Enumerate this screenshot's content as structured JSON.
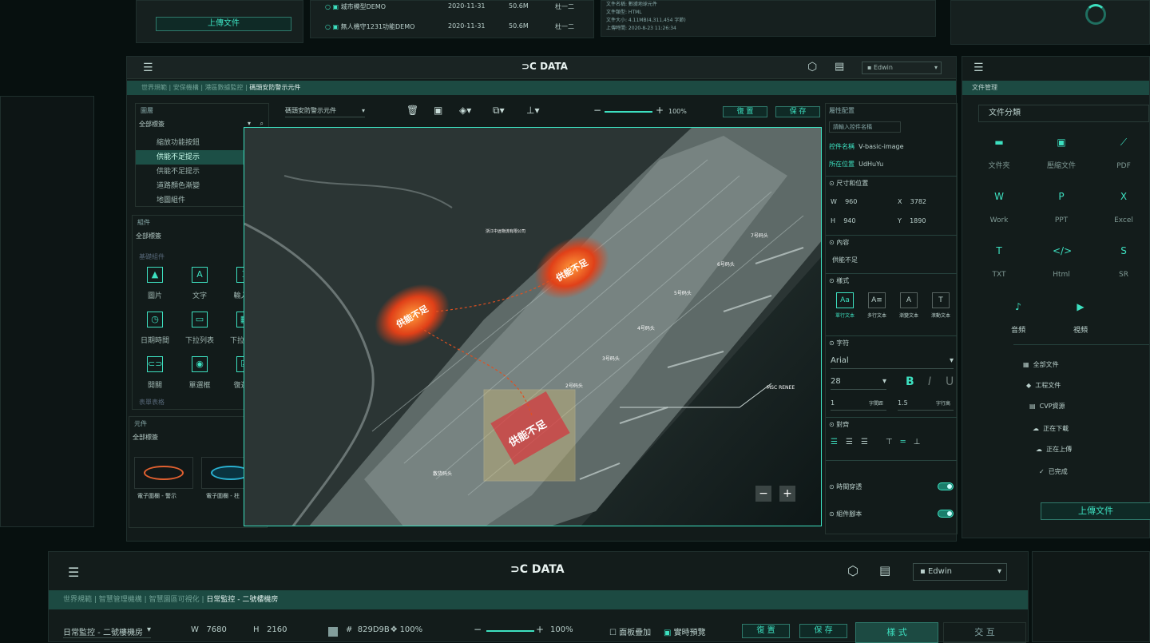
{
  "top_strip": {
    "upload_label": "上傳文件",
    "files": [
      {
        "name": "城市模型DEMO",
        "date": "2020-11-31",
        "size": "50.6M",
        "owner": "杜一二"
      },
      {
        "name": "無人機守1231功能DEMO",
        "date": "2020-11-31",
        "size": "50.6M",
        "owner": "杜一二"
      }
    ],
    "info_lines": [
      "文件名稱:   數據地球元件",
      "文件類型:   HTML",
      "文件大小:   4.11MB(4,311,454 字節)",
      "上傳時間:   2020-8-23   11:26:34"
    ]
  },
  "header": {
    "logo_text": "DATA",
    "user": "Edwin"
  },
  "breadcrumb": {
    "items": [
      "世界規範",
      "安保機構",
      "港區數據監控"
    ],
    "current": "碼頭安防警示元件"
  },
  "layers_panel": {
    "title": "圖層",
    "filter": "全部標簽",
    "items": [
      "縮放功能按鈕",
      "供能不足提示",
      "供能不足提示",
      "道路顏色漸變",
      "地圖組件"
    ]
  },
  "components_panel": {
    "title": "組件",
    "filter": "全部標簽",
    "basic_label": "基礎組件",
    "items": [
      "圖片",
      "文字",
      "輸入框",
      "日期時間",
      "下拉列表",
      "下拉日曆",
      "開關",
      "單選框",
      "復選框"
    ],
    "form_label": "表單表格"
  },
  "elements_panel": {
    "title": "元件",
    "filter": "全部標簽",
    "items": [
      "電子圍欄 - 警示",
      "電子圍欄 - 柱"
    ]
  },
  "canvas_toolbar": {
    "selector": "碼頭安防警示元件",
    "zoom": "100%",
    "reset": "復 置",
    "save": "保 存"
  },
  "map": {
    "alerts": [
      "供能不足",
      "供能不足",
      "供能不足"
    ],
    "labels": [
      "2号码头",
      "3号码头",
      "4号码头",
      "5号码头",
      "6号码头",
      "7号码头",
      "MSC RENEE",
      "散货码头",
      "浙江中远物流有限公司"
    ]
  },
  "props_panel": {
    "title": "屬性配置",
    "search_placeholder": "請輸入控件名稱",
    "control_label": "控件名稱",
    "control_value": "V-basic-image",
    "pos_label": "所在位置",
    "pos_value": "UdHuYu",
    "size_section": "尺寸和位置",
    "w": "960",
    "x": "3782",
    "h": "940",
    "y": "1890",
    "content_section": "內容",
    "content_value": "供能不足",
    "style_section": "樣式",
    "text_styles": [
      "單行文本",
      "多行文本",
      "漸變文本",
      "滾動文本"
    ],
    "font_section": "字符",
    "font": "Arial",
    "font_size": "28",
    "bold": "B",
    "italic": "I",
    "underline": "U",
    "letter_spacing_val": "1",
    "letter_spacing_label": "字間距",
    "line_height_val": "1.5",
    "line_height_label": "字行高",
    "align_section": "對齊",
    "time_pierce": "時間穿透",
    "component_script": "組件腳本"
  },
  "file_panel": {
    "title": "文件管理",
    "category": "文件分類",
    "icons": [
      "文件夾",
      "壓縮文件",
      "PDF",
      "Work",
      "PPT",
      "Excel",
      "TXT",
      "Html",
      "SR",
      "音頻",
      "視頻"
    ],
    "nav": [
      "全部文件",
      "工程文件",
      "CVP資源",
      "正在下載",
      "正在上傳",
      "已完成"
    ],
    "upload": "上傳文件"
  },
  "bottom_bar": {
    "logo_text": "DATA",
    "user": "Edwin",
    "breadcrumb": [
      "世界規範",
      "智慧管理機構",
      "智慧園區可視化"
    ],
    "current": "日常監控 - 二號樓機房",
    "selector": "日常監控 - 二號樓機房",
    "w": "7680",
    "h": "2160",
    "color": "829D9B",
    "opacity": "100%",
    "zoom": "100%",
    "overlay": "面板疊加",
    "preview": "實時預覽",
    "reset": "復 置",
    "save": "保 存",
    "tab_style": "樣 式",
    "tab_interact": "交 互"
  }
}
